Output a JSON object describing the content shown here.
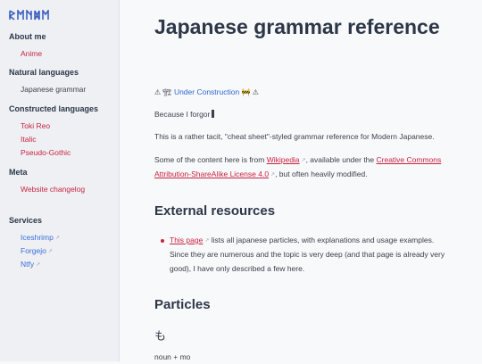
{
  "sidebar": {
    "logo_text": "ᚱᛗᚹᛞᛗ",
    "sections": [
      {
        "heading": "About me",
        "links": [
          {
            "label": "Anime",
            "style": "red"
          }
        ]
      },
      {
        "heading": "Natural languages",
        "links": [
          {
            "label": "Japanese grammar",
            "style": "plain"
          }
        ]
      },
      {
        "heading": "Constructed languages",
        "links": [
          {
            "label": "Toki Reo",
            "style": "red"
          },
          {
            "label": "Italic",
            "style": "red"
          },
          {
            "label": "Pseudo-Gothic",
            "style": "red"
          }
        ]
      },
      {
        "heading": "Meta",
        "links": [
          {
            "label": "Website changelog",
            "style": "red"
          }
        ]
      },
      {
        "heading": "Services",
        "links": [
          {
            "label": "Iceshrimp",
            "style": "blue",
            "external": true
          },
          {
            "label": "Forgejo",
            "style": "blue",
            "external": true
          },
          {
            "label": "Ntfy",
            "style": "blue",
            "external": true
          }
        ]
      }
    ]
  },
  "main": {
    "title": "Japanese grammar reference",
    "construction": {
      "prefix": "⚠ 🏗",
      "label": "Under Construction",
      "suffix": "🚧 ⚠"
    },
    "because": "Because I forgor",
    "intro": "This is a rather tacit, \"cheat sheet\"-styled grammar reference for Modern Japanese.",
    "content_note": {
      "before": "Some of the content here is from ",
      "wiki": "Wikipedia",
      "middle": ", available under the ",
      "license": "Creative Commons Attribution-ShareAlike License 4.0",
      "after": ", but often heavily modified."
    },
    "external_heading": "External resources",
    "resource": {
      "link": "This page",
      "text": " lists all japanese particles, with explanations and usage examples. Since they are numerous and the topic is very deep (and that page is already very good), I have only described a few here."
    },
    "particles_heading": "Particles",
    "particle_kana": "も",
    "particle_formula": "noun + mo"
  },
  "colors": {
    "accent": "#c8233f",
    "link_blue": "#2f66d0",
    "sidebar_bg": "#eef0f4"
  }
}
